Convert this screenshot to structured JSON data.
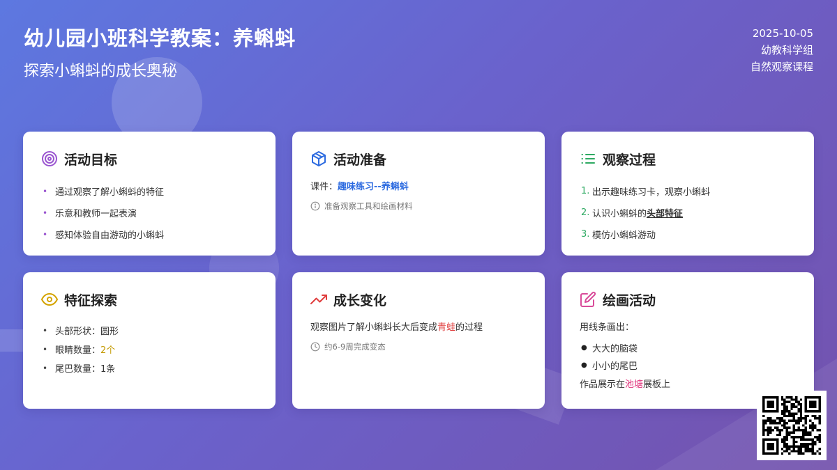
{
  "header": {
    "title": "幼儿园小班科学教案：养蝌蚪",
    "subtitle": "探索小蝌蚪的成长奥秘"
  },
  "meta": {
    "date": "2025-10-05",
    "group": "幼教科学组",
    "course": "自然观察课程"
  },
  "cards": {
    "goals": {
      "title": "活动目标",
      "icon": "target-icon",
      "items": [
        "通过观察了解小蝌蚪的特征",
        "乐意和教师一起表演",
        "感知体验自由游动的小蝌蚪"
      ]
    },
    "prep": {
      "title": "活动准备",
      "icon": "box-icon",
      "courseware_label": "课件：",
      "courseware_value": "趣味练习--养蝌蚪",
      "note": "准备观察工具和绘画材料"
    },
    "process": {
      "title": "观察过程",
      "icon": "list-icon",
      "items": [
        {
          "num": "1.",
          "text": "出示趣味练习卡，观察小蝌蚪"
        },
        {
          "num": "2.",
          "text_before": "认识小蝌蚪的",
          "text_emph": "头部特征"
        },
        {
          "num": "3.",
          "text": "模仿小蝌蚪游动"
        }
      ]
    },
    "features": {
      "title": "特征探索",
      "icon": "eye-icon",
      "items": [
        {
          "label": "头部形状：",
          "value": "圆形"
        },
        {
          "label": "眼睛数量：",
          "value": "2个"
        },
        {
          "label": "尾巴数量：",
          "value": "1条"
        }
      ]
    },
    "growth": {
      "title": "成长变化",
      "icon": "trending-up-icon",
      "text_before": "观察图片了解小蝌蚪长大后变成",
      "text_emph": "青蛙",
      "text_after": "的过程",
      "note": "约6-9周完成变态"
    },
    "drawing": {
      "title": "绘画活动",
      "icon": "edit-icon",
      "intro": "用线条画出：",
      "items": [
        "大大的脑袋",
        "小小的尾巴"
      ],
      "after_before": "作品展示在",
      "after_emph": "池塘",
      "after_after": "展板上"
    }
  },
  "colors": {
    "goals_icon": "#9a55d0",
    "prep_icon": "#2d6be0",
    "process_icon": "#2eaa62",
    "features_icon": "#d4a400",
    "growth_icon": "#e03e3e",
    "drawing_icon": "#d94c9a"
  }
}
